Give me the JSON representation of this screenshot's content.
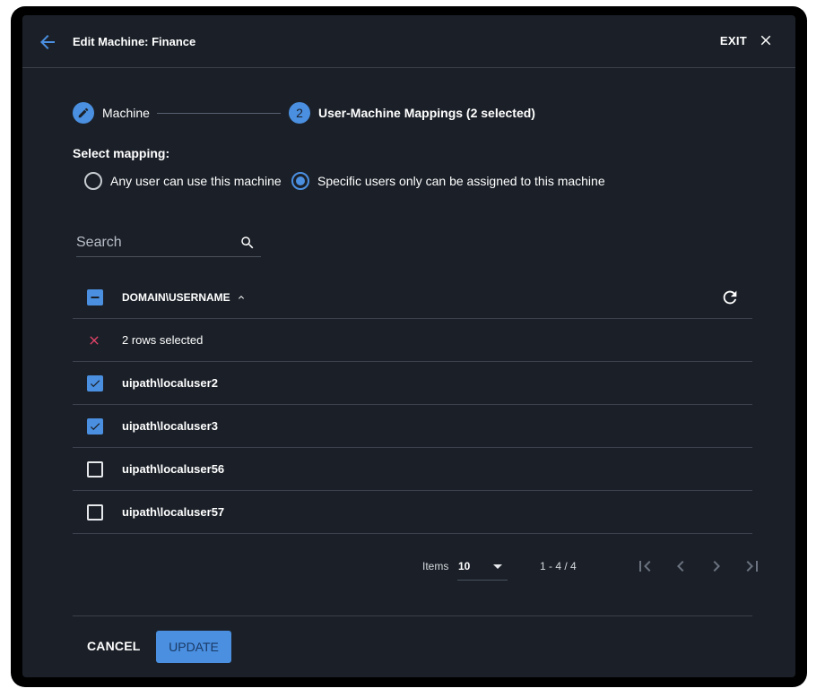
{
  "header": {
    "title": "Edit Machine: Finance",
    "exit_label": "EXIT"
  },
  "stepper": {
    "steps": [
      {
        "label": "Machine",
        "icon": "pencil-icon",
        "state": "completed"
      },
      {
        "number": "2",
        "label": "User-Machine Mappings (2 selected)",
        "state": "active"
      }
    ]
  },
  "mapping": {
    "label": "Select mapping:",
    "options": [
      {
        "label": "Any user can use this machine",
        "selected": false
      },
      {
        "label": "Specific users only can be assigned to this machine",
        "selected": true
      }
    ]
  },
  "search": {
    "placeholder": "Search"
  },
  "table": {
    "column_header": "DOMAIN\\USERNAME",
    "sort": "ascending",
    "header_checkbox": "indeterminate",
    "selection_text": "2 rows selected",
    "rows": [
      {
        "username": "uipath\\localuser2",
        "checked": true
      },
      {
        "username": "uipath\\localuser3",
        "checked": true
      },
      {
        "username": "uipath\\localuser56",
        "checked": false
      },
      {
        "username": "uipath\\localuser57",
        "checked": false
      }
    ]
  },
  "paginator": {
    "items_label": "Items",
    "page_size": "10",
    "range": "1 - 4 / 4"
  },
  "footer": {
    "cancel_label": "CANCEL",
    "update_label": "UPDATE"
  },
  "colors": {
    "background": "#1b2028",
    "accent": "#4a8fe0",
    "danger": "#e8456b"
  }
}
